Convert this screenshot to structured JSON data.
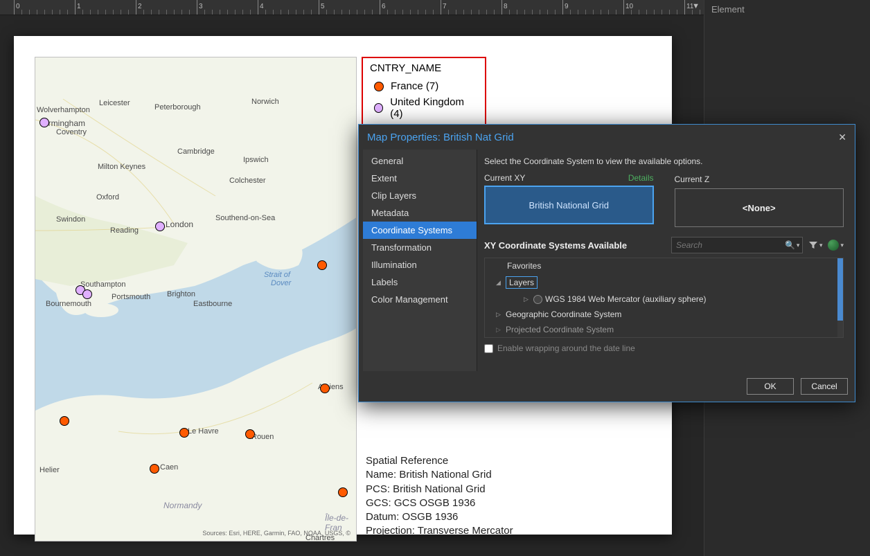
{
  "right_panel": {
    "title": "Element"
  },
  "ruler": {
    "arrow": "▼"
  },
  "legend": {
    "title": "CNTRY_NAME",
    "items": [
      {
        "label": "France (7)",
        "color": "#ff5a00"
      },
      {
        "label": "United Kingdom (4)",
        "color": "#e0b0ff"
      }
    ]
  },
  "spatref": {
    "l0": "Spatial Reference",
    "l1": "Name: British National Grid",
    "l2": "PCS: British National Grid",
    "l3": "GCS: GCS OSGB 1936",
    "l4": "Datum: OSGB 1936",
    "l5": "Projection: Transverse Mercator"
  },
  "map": {
    "sources": "Sources: Esri, HERE, Garmin, FAO, NOAA, USGS, ©",
    "cities": {
      "c0": "Wolverhampton",
      "c1": "Birmingham",
      "c2": "Coventry",
      "c3": "Leicester",
      "c4": "Peterborough",
      "c5": "Norwich",
      "c6": "Milton Keynes",
      "c7": "Cambridge",
      "c8": "Ipswich",
      "c9": "Colchester",
      "c10": "Oxford",
      "c11": "Swindon",
      "c12": "Reading",
      "c13": "London",
      "c14": "Southend-on-Sea",
      "c15": "Southampton",
      "c16": "Portsmouth",
      "c17": "Bournemouth",
      "c18": "Brighton",
      "c19": "Eastbourne",
      "c20": "Caen",
      "c21": "Le Havre",
      "c22": "Rouen",
      "c23": "Amiens",
      "c24": "Helier",
      "c25": "Chartres",
      "c26": "Île-de-Fran",
      "c27": "Normandy",
      "c28": "Strait of",
      "c29": "Dover"
    }
  },
  "dialog": {
    "title": "Map Properties: British Nat Grid",
    "nav": {
      "n0": "General",
      "n1": "Extent",
      "n2": "Clip Layers",
      "n3": "Metadata",
      "n4": "Coordinate Systems",
      "n5": "Transformation",
      "n6": "Illumination",
      "n7": "Labels",
      "n8": "Color Management"
    },
    "hint": "Select the Coordinate System to view the available options.",
    "current_xy_label": "Current XY",
    "details_label": "Details",
    "current_z_label": "Current Z",
    "current_xy_value": "British National Grid",
    "current_z_value": "<None>",
    "avail_label": "XY Coordinate Systems Available",
    "search_placeholder": "Search",
    "tree": {
      "favorites": "Favorites",
      "layers": "Layers",
      "wgs": "WGS 1984 Web Mercator (auxiliary sphere)",
      "gcs": "Geographic Coordinate System",
      "pcs": "Projected Coordinate System"
    },
    "wrap_label": "Enable wrapping around the date line",
    "ok": "OK",
    "cancel": "Cancel"
  }
}
